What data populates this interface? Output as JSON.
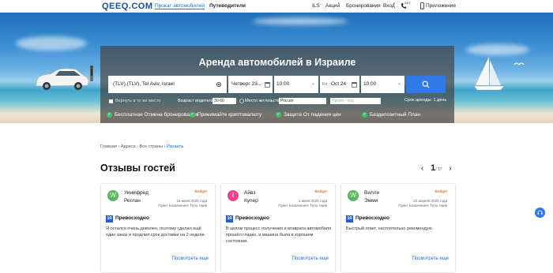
{
  "header": {
    "logo": "QEEQ.COM",
    "nav": {
      "car_rental": "Прокат автомобилей",
      "guides": "Путеводители",
      "currency": "ILS",
      "deals": "Акции",
      "bookings": "Бронирования",
      "login": "Вход",
      "support": "24/7",
      "app": "Приложение"
    }
  },
  "hero": {
    "title": "Аренда автомобилей в Израиле",
    "pickup_location": "(TLV),(TLV), Tel Aviv, Israel",
    "pickup_date": "Четверг 23...",
    "pickup_time": "10:00",
    "return_date_day": "Fri",
    "return_date": "Oct 24",
    "return_time": "10:00",
    "return_same_place_label": "Вернуть в то же место",
    "driver_age_label": "Возраст водителя:",
    "driver_age_value": "30-60",
    "residence_label": "Место жительства:",
    "residence_value": "Россия",
    "promo_placeholder": "Промо - код",
    "rental_duration": "Срок аренды: 1 день",
    "features": [
      "Бесплатная Отмена бронирования",
      "Принимайте криптовалюту",
      "Защита От падения цен",
      "Бездепозитный План"
    ]
  },
  "breadcrumb": {
    "home": "Главная",
    "sep1": " › ",
    "addresses": "Адреса",
    "sep2": " › ",
    "all_countries": "Все страны",
    "sep3": " › ",
    "current": "Израиль"
  },
  "reviews": {
    "title": "Отзывы гостей",
    "page_current": "1",
    "page_total": "/ 17",
    "cards": [
      {
        "initial": "W",
        "avatar_color": "#5cb85c",
        "first_name": "Уинифред",
        "last_name": "Реглан",
        "brand": "Budget",
        "date": "18 июня 2025 года",
        "destination": "Пункт назначения: Тель-Авив",
        "score": "10",
        "rating": "Превосходно",
        "text": "Я остался очень доволен, поэтому сделал ещё один заказ и продлил срок доставки на 2 недели.",
        "more": "Посмотреть еще"
      },
      {
        "initial": "I",
        "avatar_color": "#e5468e",
        "first_name": "Айвз",
        "last_name": "Купер",
        "brand": "Budget",
        "date": "1 июня 2025 года",
        "destination": "Пункт назначения: Тель-Авив",
        "score": "10",
        "rating": "Превосходно",
        "text": "В целом процесс получения и возврата автомобиля прошёл гладко, и машина была в хорошем состоянии.",
        "more": "Посмотреть еще"
      },
      {
        "initial": "W",
        "avatar_color": "#5cb85c",
        "first_name": "Вилли",
        "last_name": "Эмми",
        "brand": "Budget",
        "date": "22 апреля 2025 года",
        "destination": "Пункт назначения: Тель-Авив",
        "score": "10",
        "rating": "Превосходно",
        "text": "Быстрый ответ, настоятельно рекомендую.",
        "more": "Посмотреть еще"
      }
    ]
  },
  "colors": {
    "accent": "#2f7ae5",
    "feature_check": "#3ec36b",
    "score_badge": "#2260c9"
  }
}
